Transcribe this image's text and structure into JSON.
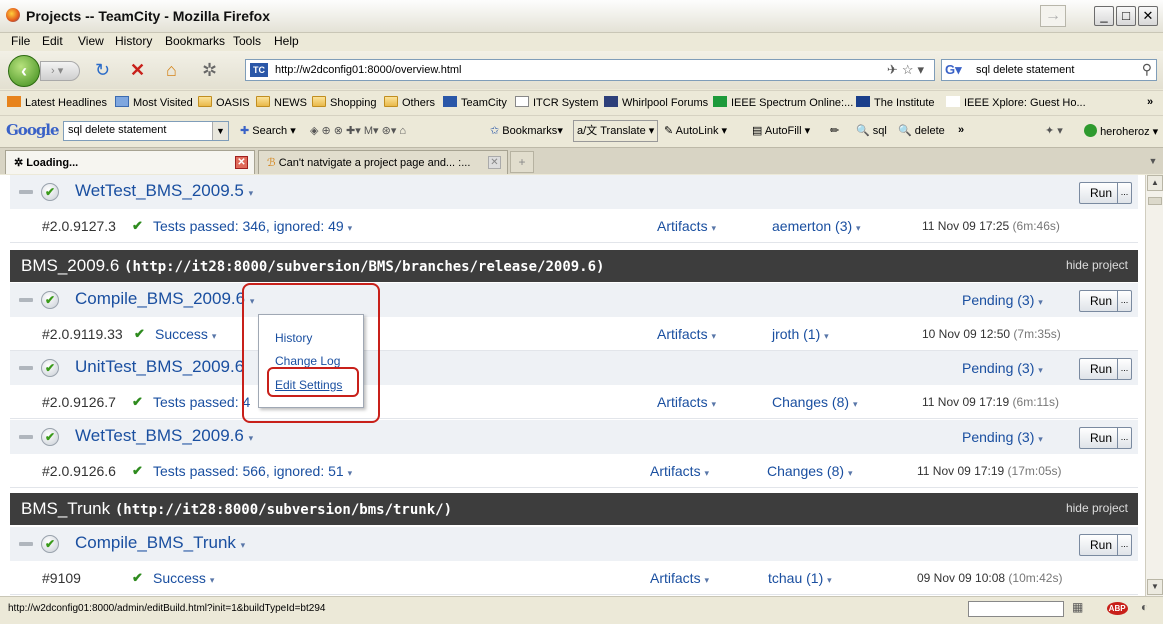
{
  "window": {
    "title": "Projects -- TeamCity - Mozilla Firefox"
  },
  "menu": [
    "File",
    "Edit",
    "View",
    "History",
    "Bookmarks",
    "Tools",
    "Help"
  ],
  "nav": {
    "url": "http://w2dconfig01:8000/overview.html",
    "search_value": "sql delete statement"
  },
  "bookmarks": [
    "Latest Headlines",
    "Most Visited",
    "OASIS",
    "NEWS",
    "Shopping",
    "Others",
    "TeamCity",
    "ITCR System",
    "Whirlpool Forums",
    "IEEE Spectrum Online:...",
    "The Institute",
    "IEEE Xplore: Guest Ho..."
  ],
  "google_toolbar": {
    "logo": "Google",
    "search_value": "sql delete statement",
    "items": [
      "Search",
      "Bookmarks",
      "Translate",
      "AutoLink",
      "AutoFill",
      "sql",
      "delete"
    ],
    "user": "heroheroz"
  },
  "tabs": [
    {
      "label": "Loading...",
      "active": true
    },
    {
      "label": "Can't natvigate a project page and... :...",
      "active": false
    }
  ],
  "content": {
    "rows_top": {
      "wettest_2009_5": {
        "name": "WetTest_BMS_2009.5",
        "run": "Run",
        "build": {
          "num": "#2.0.9127.3",
          "status": "Tests passed: 346, ignored: 49",
          "artifacts": "Artifacts",
          "changes": "aemerton (3)",
          "date": "11 Nov 09 17:25",
          "duration": "(6m:46s)"
        }
      }
    },
    "project_2009_6": {
      "name": "BMS_2009.6",
      "url": "(http://it28:8000/subversion/BMS/branches/release/2009.6)",
      "hide": "hide project",
      "configs": [
        {
          "name": "Compile_BMS_2009.6",
          "pending": "Pending (3)",
          "run": "Run",
          "build": {
            "num": "#2.0.9119.33",
            "status": "Success",
            "artifacts": "Artifacts",
            "changes": "jroth (1)",
            "date": "10 Nov 09 12:50",
            "duration": "(7m:35s)"
          }
        },
        {
          "name": "UnitTest_BMS_2009.6",
          "pending": "Pending (3)",
          "run": "Run",
          "build": {
            "num": "#2.0.9126.7",
            "status": "Tests passed: 4",
            "artifacts": "Artifacts",
            "changes": "Changes (8)",
            "date": "11 Nov 09 17:19",
            "duration": "(6m:11s)"
          }
        },
        {
          "name": "WetTest_BMS_2009.6",
          "pending": "Pending (3)",
          "run": "Run",
          "build": {
            "num": "#2.0.9126.6",
            "status": "Tests passed: 566, ignored: 51",
            "artifacts": "Artifacts",
            "changes": "Changes (8)",
            "date": "11 Nov 09 17:19",
            "duration": "(17m:05s)"
          }
        }
      ]
    },
    "project_trunk": {
      "name": "BMS_Trunk",
      "url": "(http://it28:8000/subversion/bms/trunk/)",
      "hide": "hide project",
      "configs": [
        {
          "name": "Compile_BMS_Trunk",
          "run": "Run",
          "build": {
            "num": "#9109",
            "status": "Success",
            "artifacts": "Artifacts",
            "changes": "tchau (1)",
            "date": "09 Nov 09 10:08",
            "duration": "(10m:42s)"
          }
        }
      ]
    },
    "popup_menu": [
      "History",
      "Change Log",
      "Edit Settings"
    ]
  },
  "status": {
    "url": "http://w2dconfig01:8000/admin/editBuild.html?init=1&buildTypeId=bt294"
  },
  "colors": {
    "link": "#1a4fa0",
    "project_header": "#3d3d3d",
    "highlight": "#c8201a",
    "success": "#2e8b1e"
  }
}
